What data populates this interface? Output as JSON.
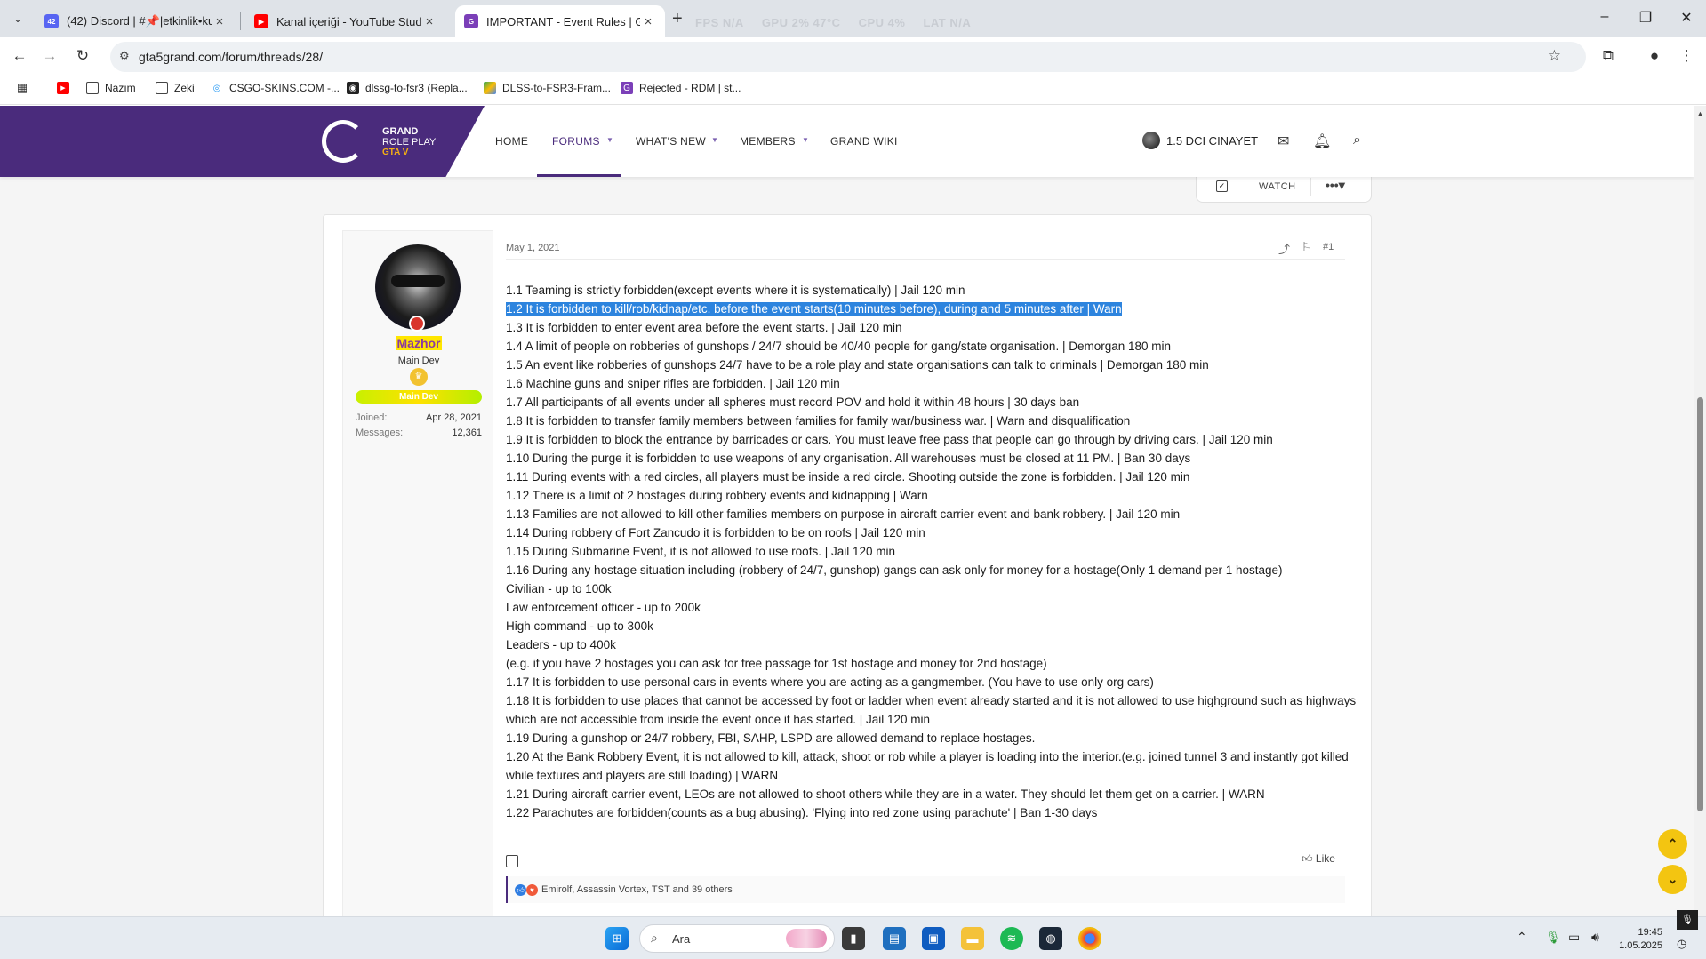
{
  "browser": {
    "tabs": [
      {
        "title": "(42) Discord | #📌|etkinlik•ku",
        "badge": "42"
      },
      {
        "title": "Kanal içeriği - YouTube Studio"
      },
      {
        "title": "IMPORTANT - Event Rules | Gra"
      }
    ],
    "perf": {
      "fps_label": "FPS",
      "fps": "N/A",
      "gpu_label": "GPU",
      "gpu": "2% 47°C",
      "cpu_label": "CPU",
      "cpu": "4%",
      "lat_label": "LAT",
      "lat": "N/A"
    },
    "url": "gta5grand.com/forum/threads/28/",
    "bookmarks": [
      "Nazım",
      "Zeki",
      "CSGO-SKINS.COM -...",
      "dlssg-to-fsr3 (Repla...",
      "DLSS-to-FSR3-Fram...",
      "Rejected - RDM | st..."
    ]
  },
  "site": {
    "logo": {
      "line1": "GRAND",
      "line2": "ROLE PLAY",
      "line3": "GTA V"
    },
    "nav": [
      "HOME",
      "FORUMS",
      "WHAT'S NEW",
      "MEMBERS",
      "GRAND WIKI"
    ],
    "user": "1.5 DCI CINAYET",
    "watch": "WATCH",
    "accent": "#4a2b7c"
  },
  "post": {
    "author": "Mazhor",
    "user_title": "Main Dev",
    "banner": "Main Dev",
    "joined_label": "Joined:",
    "joined": "Apr 28, 2021",
    "messages_label": "Messages:",
    "messages": "12,361",
    "date": "May 1, 2021",
    "number": "#1",
    "lines": [
      "1.1 Teaming is strictly forbidden(except events where it is systematically) | Jail 120 min",
      "1.2 It is forbidden to kill/rob/kidnap/etc. before the event starts(10 minutes before), during and 5 minutes after | Warn",
      "1.3 It is forbidden to enter event area before the event starts. | Jail 120 min",
      "1.4 A limit of people on robberies of gunshops / 24/7 should be 40/40 people for gang/state organisation. | Demorgan 180 min",
      "1.5 An event like robberies of gunshops 24/7 have to be a role play and state organisations can talk to criminals | Demorgan 180 min",
      "1.6 Machine guns and sniper rifles are forbidden. | Jail 120 min",
      "1.7 All participants of all events under all spheres must record POV and hold it within 48 hours | 30 days ban",
      "1.8 It is forbidden to transfer family members between families for family war/business war. | Warn and disqualification",
      "1.9 It is forbidden to block the entrance by barricades or cars. You must leave free pass that people can go through by driving cars. | Jail 120 min",
      "1.10 During the purge it is forbidden to use weapons of any organisation. All warehouses must be closed at 11 PM. | Ban 30 days",
      "1.11 During events with a red circles, all players must be inside a red circle. Shooting outside the zone is forbidden. | Jail 120 min",
      "1.12 There is a limit of 2 hostages during robbery events and kidnapping | Warn",
      "1.13 Families are not allowed to kill other families members on purpose in aircraft carrier event and bank robbery. | Jail 120 min",
      "1.14 During robbery of Fort Zancudo it is forbidden to be on roofs | Jail 120 min",
      "1.15 During Submarine Event, it is not allowed to use roofs. | Jail 120 min",
      "1.16 During any hostage situation including (robbery of 24/7, gunshop) gangs can ask only for money for a hostage(Only 1 demand per 1 hostage)",
      "Civilian - up to 100k",
      "Law enforcement officer - up to 200k",
      "High command - up to 300k",
      "Leaders - up to 400k",
      "(e.g. if you have 2 hostages you can ask for free passage for 1st hostage and money for 2nd hostage)",
      "1.17 It is forbidden to use personal cars in events where you are acting as a gangmember. (You have to use only org cars)",
      "1.18 It is forbidden to use places that cannot be accessed by foot or ladder when event already started and it is not allowed to use highground such as highways which are not accessible from inside the event once it has started. | Jail 120 min",
      "1.19 During a gunshop or 24/7 robbery, FBI, SAHP, LSPD are allowed demand to replace hostages.",
      "1.20 At the Bank Robbery Event, it is not allowed to kill, attack, shoot or rob while a player is loading into the interior.(e.g. joined tunnel 3 and instantly got killed while textures and players are still loading) | WARN",
      "1.21 During aircraft carrier event, LEOs are not allowed to shoot others while they are in a water. They should let them get on a carrier. | WARN",
      "1.22 Parachutes are forbidden(counts as a bug abusing). 'Flying into red zone using parachute' | Ban 1-30 days"
    ],
    "like": "Like",
    "reactions": "Emirolf, Assassin Vortex, TST and 39 others"
  },
  "taskbar": {
    "search": "Ara",
    "time": "19:45",
    "date": "1.05.2025"
  }
}
